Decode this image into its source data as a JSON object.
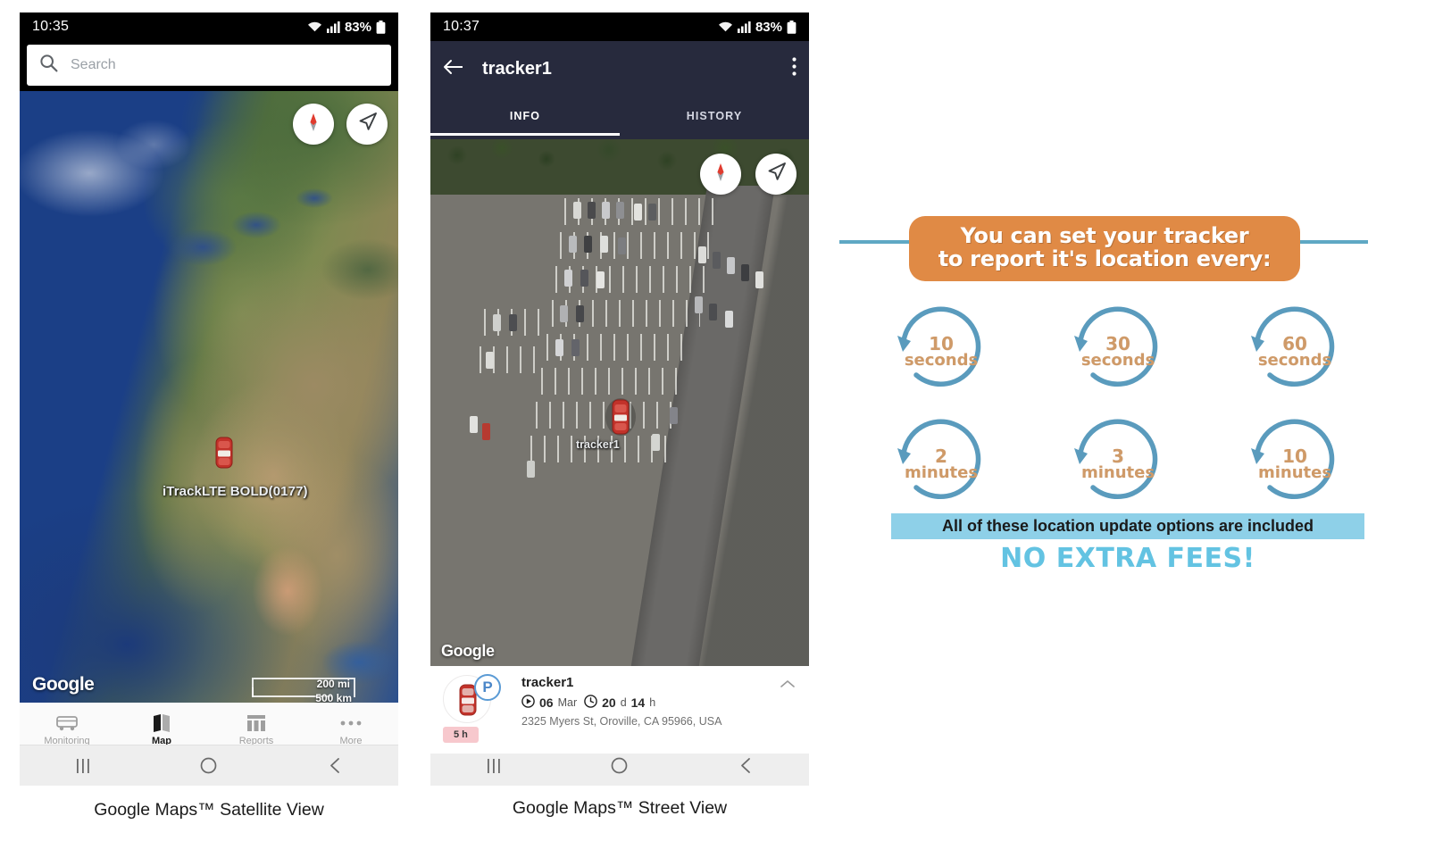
{
  "phone1": {
    "status": {
      "time": "10:35",
      "battery": "83%",
      "wifi_icon": "wifi-icon",
      "signal_icon": "signal-bars-icon",
      "battery_icon": "battery-icon"
    },
    "search": {
      "placeholder": "Search",
      "value": "",
      "icon": "search-icon"
    },
    "map": {
      "controls": [
        {
          "name": "compass-button",
          "icon": "compass-icon"
        },
        {
          "name": "my-location-button",
          "icon": "navigation-arrow-icon"
        }
      ],
      "marker_label": "iTrackLTE BOLD(0177)",
      "marker_icon": "car-marker-icon",
      "attribution": "Google",
      "scale_mi": "200 mi",
      "scale_km": "500 km"
    },
    "tabbar": [
      {
        "label": "Monitoring",
        "icon": "vehicle-icon",
        "active": false
      },
      {
        "label": "Map",
        "icon": "map-icon",
        "active": true
      },
      {
        "label": "Reports",
        "icon": "reports-icon",
        "active": false
      },
      {
        "label": "More",
        "icon": "more-dots-icon",
        "active": false
      }
    ],
    "navbar": [
      {
        "name": "recents-button",
        "icon": "recents-icon"
      },
      {
        "name": "home-button",
        "icon": "home-circle-icon"
      },
      {
        "name": "back-button",
        "icon": "back-chevron-icon"
      }
    ],
    "caption": "Google Maps™ Satellite View"
  },
  "phone2": {
    "status": {
      "time": "10:37",
      "battery": "83%",
      "wifi_icon": "wifi-icon",
      "signal_icon": "signal-bars-icon",
      "battery_icon": "battery-icon"
    },
    "appbar": {
      "back_icon": "back-arrow-icon",
      "title": "tracker1",
      "overflow_icon": "overflow-menu-icon"
    },
    "tabs": [
      {
        "label": "INFO",
        "active": true
      },
      {
        "label": "HISTORY",
        "active": false
      }
    ],
    "map": {
      "controls": [
        {
          "name": "compass-button",
          "icon": "compass-icon"
        },
        {
          "name": "my-location-button",
          "icon": "navigation-arrow-icon"
        }
      ],
      "marker_label": "tracker1",
      "marker_icon": "car-marker-icon",
      "attribution": "Google"
    },
    "card": {
      "avatar_icon": "car-top-view-icon",
      "status_badge": "P",
      "name": "tracker1",
      "date_icon": "play-circle-icon",
      "date_value": "06",
      "date_unit": "Mar",
      "duration_icon": "clock-icon",
      "duration_days_value": "20",
      "duration_days_unit": "d",
      "duration_hours_value": "14",
      "duration_hours_unit": "h",
      "address": "2325 Myers St, Oroville, CA 95966, USA",
      "hours_badge": "5 h",
      "collapse_icon": "chevron-up-icon"
    },
    "navbar": [
      {
        "name": "recents-button",
        "icon": "recents-icon"
      },
      {
        "name": "home-button",
        "icon": "home-circle-icon"
      },
      {
        "name": "back-button",
        "icon": "back-chevron-icon"
      }
    ],
    "caption": "Google Maps™ Street View"
  },
  "infographic": {
    "headline_line1": "You can set your tracker",
    "headline_line2": "to report it's location every:",
    "intervals": [
      {
        "number": "10",
        "unit": "seconds"
      },
      {
        "number": "30",
        "unit": "seconds"
      },
      {
        "number": "60",
        "unit": "seconds"
      },
      {
        "number": "2",
        "unit": "minutes"
      },
      {
        "number": "3",
        "unit": "minutes"
      },
      {
        "number": "10",
        "unit": "minutes"
      }
    ],
    "subtitle": "All of these location update options are included",
    "fees": "NO EXTRA FEES!",
    "colors": {
      "banner_orange": "#e08a45",
      "line_blue": "#5fa8c4",
      "circle_blue": "#5a9bbd",
      "interval_text": "#cf9a68",
      "highlight_blue": "#8ed0e8",
      "fees_blue": "#63c3e2"
    }
  }
}
